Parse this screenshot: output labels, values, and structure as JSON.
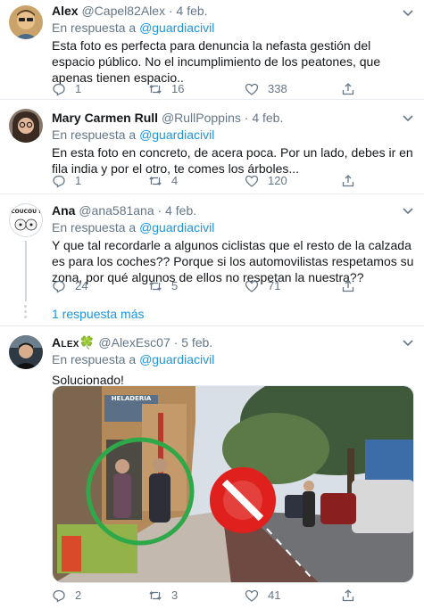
{
  "tweets": [
    {
      "name": "Alex",
      "handle": "@Capel82Alex",
      "date": "4 feb.",
      "reply_label": "En respuesta a",
      "reply_to": "@guardiacivil",
      "text": "Esta foto es perfecta para denuncia la nefasta gestión del espacio público. No el incumplimiento de los peatones, que apenas tienen espacio..",
      "replies": "1",
      "retweets": "16",
      "likes": "338"
    },
    {
      "name": "Mary Carmen Rull",
      "handle": "@RullPoppins",
      "date": "4 feb.",
      "reply_label": "En respuesta a",
      "reply_to": "@guardiacivil",
      "text": "En esta foto en concreto, de acera poca. Por un lado, debes ir en fila india y por el otro, te comes los árboles...",
      "replies": "1",
      "retweets": "4",
      "likes": "120"
    },
    {
      "name": "Ana",
      "handle": "@ana581ana",
      "date": "4 feb.",
      "reply_label": "En respuesta a",
      "reply_to": "@guardiacivil",
      "text": "Y que tal recordarle a algunos ciclistas que el resto de la calzada es para los coches?? Porque si los automovilistas respetamos su zona, por qué algunos de ellos no respetan la nuestra??",
      "replies": "24",
      "retweets": "5",
      "likes": "71",
      "avatar_text": "COUCOU !"
    },
    {
      "name": "Alex",
      "name_emoji": "🍀",
      "handle": "@AlexEsc07",
      "date": "5 feb.",
      "reply_label": "En respuesta a",
      "reply_to": "@guardiacivil",
      "text": "Solucionado!",
      "replies": "2",
      "retweets": "3",
      "likes": "41",
      "media_sign_text": "HELADERIA"
    }
  ],
  "more_replies": "1 respuesta más",
  "separator_dot": "·",
  "colors": {
    "link": "#1b95e0",
    "muted": "#657786",
    "border": "#e6ecf0",
    "green_circle": "#2fa84a",
    "red_sign": "#e0201c",
    "clover": "#3fb04b"
  },
  "icons": [
    "reply-icon",
    "retweet-icon",
    "like-icon",
    "share-icon",
    "chevron-down-icon",
    "no-entry-sign",
    "check-circle"
  ]
}
